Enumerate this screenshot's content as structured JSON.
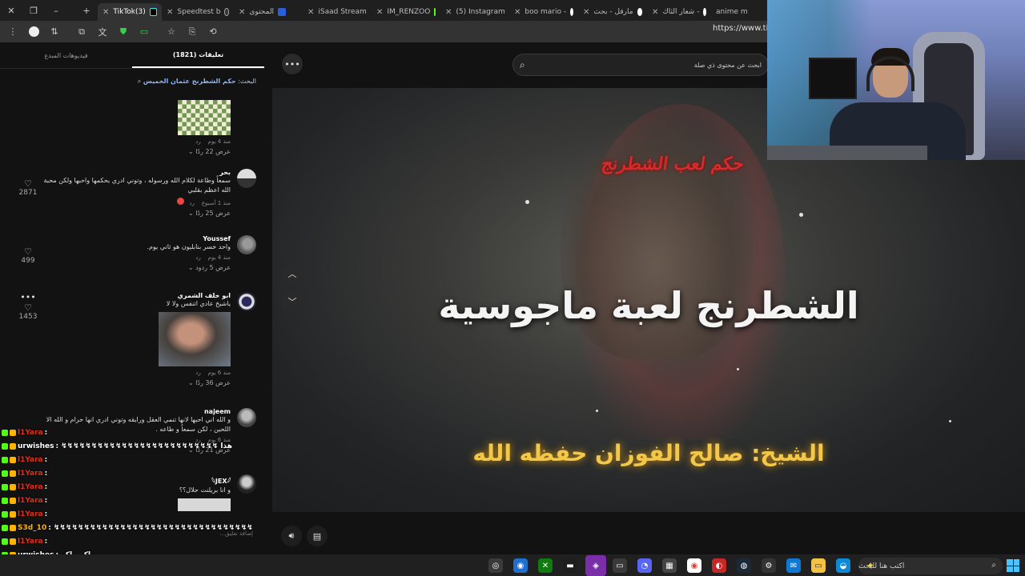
{
  "browser": {
    "tabs": [
      {
        "label": "TikTok(3)",
        "active": true
      },
      {
        "label": "Speedtest b",
        "active": false
      },
      {
        "label": "المحتوى",
        "active": false
      },
      {
        "label": "iSaad Stream",
        "active": false
      },
      {
        "label": "IM_RENZOO",
        "active": false
      },
      {
        "label": "(5) Instagram",
        "active": false
      },
      {
        "label": "boo mario -",
        "active": false
      },
      {
        "label": "مارفل - بحث",
        "active": false
      },
      {
        "label": "شعار الثاك -",
        "active": false
      },
      {
        "label": "anime m",
        "active": false
      }
    ],
    "new_tab_label": "+",
    "close_label": "✕",
    "address": "https://www.tikto"
  },
  "panel": {
    "tab_creator_videos": "فيديوهات المبدع",
    "tab_comments": "(1821) تعليقات",
    "search_prefix": "البحث:",
    "search_query": "حكم الشطرنج عثمان الخميس",
    "comments": [
      {
        "name": "",
        "text": "",
        "time": "منذ 4 يوم",
        "reply": "رد",
        "replies": "عرض 22 ردًا",
        "likes": ""
      },
      {
        "name": "بحر",
        "text": "سمعاً وطاعة لكلام الله ورسوله ، وتوني ادري بحكمها واحبها ولكن محبة الله اعظم بقلبي",
        "time": "منذ 1 أسبوع",
        "reply": "رد",
        "replies": "عرض 25 ردًا",
        "likes": "2871"
      },
      {
        "name": "Youssef",
        "text": "واحد خسر بنابليون هو ثاني يوم.",
        "time": "منذ 4 يوم",
        "reply": "رد",
        "replies": "عرض 5 ردود",
        "likes": "499"
      },
      {
        "name": "ابو خلف الشمري",
        "text": "ياشيخ عادي اتنفس ولا لا",
        "time": "منذ 6 يوم",
        "reply": "رد",
        "replies": "عرض 36 ردًا",
        "likes": "1453"
      },
      {
        "name": "najeem",
        "text": "و الله اني احبها لانها تنمي العقل ورايقه وتوني ادري انها حرام و الله الا اللحين ، لكن سمعاً و طاعه .",
        "time": "منذ 6 يوم",
        "reply": "رد",
        "replies": "عرض 21 ردًا",
        "likes": ""
      },
      {
        "name": "𓆩JEX𓆪",
        "text": "و انا بريلنت حلال؟؟",
        "time": "",
        "reply": "",
        "replies": "",
        "likes": ""
      }
    ],
    "comment_input_placeholder": "إضافة تعليق..."
  },
  "chat": {
    "lines": [
      {
        "user": "l1Yara",
        "msg": ":",
        "color": "#e0301e"
      },
      {
        "user": "urwishes",
        "msg": ": ↯↯↯↯↯↯↯↯↯↯↯↯↯↯↯↯↯↯↯↯↯↯↯↯↯↯ هذا",
        "color": "#ffffff"
      },
      {
        "user": "l1Yara",
        "msg": ":",
        "color": "#e0301e"
      },
      {
        "user": "l1Yara",
        "msg": ":",
        "color": "#e0301e"
      },
      {
        "user": "l1Yara",
        "msg": ":",
        "color": "#e0301e"
      },
      {
        "user": "l1Yara",
        "msg": ":",
        "color": "#e0301e"
      },
      {
        "user": "l1Yara",
        "msg": ":",
        "color": "#e0301e"
      },
      {
        "user": "S3d_10",
        "msg": ": ↯↯↯↯↯↯↯↯↯↯↯↯↯↯↯↯↯↯↯↯↯↯↯↯↯↯↯↯↯↯↯↯↯",
        "color": "#ffb300"
      },
      {
        "user": "l1Yara",
        "msg": ":",
        "color": "#e0301e"
      },
      {
        "user": "urwishes",
        "msg": ": ماكو ماكو",
        "color": "#ffffff"
      },
      {
        "user": "l1Yara",
        "msg": ": ↯↯↯↯↯↯↯↯↯↯↯↯↯↯↯↯↯↯↯↯↯↯↯↯↯↯↯↯↯↯",
        "color": "#e0301e"
      }
    ]
  },
  "video": {
    "search_placeholder": "ابحث عن محتوى ذي صلة",
    "small_title": "حكم لعب الشطرنج",
    "main_title": "الشطرنج لعبة ماجوسية",
    "sheikh": "الشيخ: صالح الفوزان حفظه الله"
  },
  "taskbar": {
    "search_placeholder": "اكتب هنا للبحث"
  },
  "colors": {
    "accent": "#fe2c55",
    "sheikh_text": "#f3c74a",
    "title_red": "#d42b2b"
  }
}
